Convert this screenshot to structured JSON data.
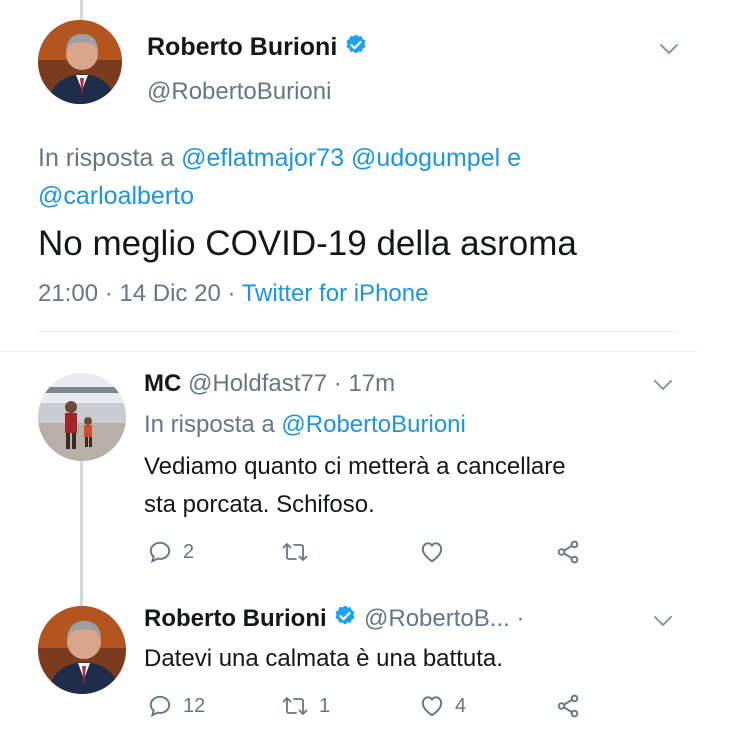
{
  "tweet": {
    "name": "Roberto Burioni",
    "handle": "@RobertoBurioni",
    "reply_prefix": "In risposta a",
    "reply_mentions": [
      "@eflatmajor73",
      "@udogumpel"
    ],
    "reply_conjunction": "e",
    "reply_mention_last": "@carloalberto",
    "text": "No meglio COVID-19 della asroma",
    "time": "21:00",
    "date": "14 Dic 20",
    "separator": "·",
    "source": "Twitter for iPhone"
  },
  "replies": [
    {
      "name": "MC",
      "handle": "@Holdfast77",
      "separator": "·",
      "time": "17m",
      "reply_prefix": "In risposta a",
      "reply_mention": "@RobertoBurioni",
      "text_lines": [
        "Vediamo quanto ci metterà a cancellare",
        "sta porcata. Schifoso."
      ],
      "reply_count": "2",
      "retweet_count": "",
      "like_count": ""
    },
    {
      "name": "Roberto Burioni",
      "handle": "@RobertoB...",
      "separator": "·",
      "text_lines": [
        "Datevi una calmata è una battuta."
      ],
      "reply_count": "12",
      "retweet_count": "1",
      "like_count": "4"
    }
  ],
  "colors": {
    "link": "#1b95e0",
    "muted": "#657786",
    "text": "#14171a",
    "verified": "#1da1f2",
    "divider": "#e6ecf0"
  }
}
